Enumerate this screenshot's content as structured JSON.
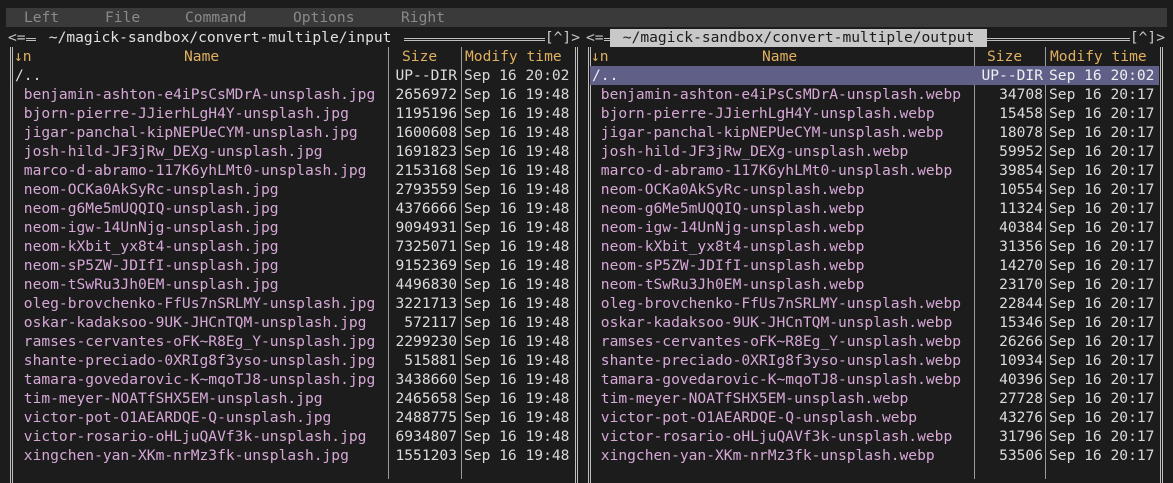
{
  "menu": [
    "Left",
    "File",
    "Command",
    "Options",
    "Right"
  ],
  "left_panel": {
    "corner_left": "<=",
    "path": " ~/magick-sandbox/convert-multiple/input ",
    "corner_right": "[^]>",
    "headers": {
      "sort": "↓n",
      "name": "Name",
      "size": "Size",
      "mtime": "Modify time"
    },
    "rows": [
      {
        "name": "/..",
        "size": "UP--DIR",
        "mtime": "Sep 16 20:02"
      },
      {
        "name": " benjamin-ashton-e4iPsCsMDrA-unsplash.jpg",
        "size": "2656972",
        "mtime": "Sep 16 19:48"
      },
      {
        "name": " bjorn-pierre-JJierhLgH4Y-unsplash.jpg",
        "size": "1195196",
        "mtime": "Sep 16 19:48"
      },
      {
        "name": " jigar-panchal-kipNEPUeCYM-unsplash.jpg",
        "size": "1600608",
        "mtime": "Sep 16 19:48"
      },
      {
        "name": " josh-hild-JF3jRw_DEXg-unsplash.jpg",
        "size": "1691823",
        "mtime": "Sep 16 19:48"
      },
      {
        "name": " marco-d-abramo-117K6yhLMt0-unsplash.jpg",
        "size": "2153168",
        "mtime": "Sep 16 19:48"
      },
      {
        "name": " neom-OCKa0AkSyRc-unsplash.jpg",
        "size": "2793559",
        "mtime": "Sep 16 19:48"
      },
      {
        "name": " neom-g6Me5mUQQIQ-unsplash.jpg",
        "size": "4376666",
        "mtime": "Sep 16 19:48"
      },
      {
        "name": " neom-igw-14UnNjg-unsplash.jpg",
        "size": "9094931",
        "mtime": "Sep 16 19:48"
      },
      {
        "name": " neom-kXbit_yx8t4-unsplash.jpg",
        "size": "7325071",
        "mtime": "Sep 16 19:48"
      },
      {
        "name": " neom-sP5ZW-JDIfI-unsplash.jpg",
        "size": "9152369",
        "mtime": "Sep 16 19:48"
      },
      {
        "name": " neom-tSwRu3Jh0EM-unsplash.jpg",
        "size": "4496830",
        "mtime": "Sep 16 19:48"
      },
      {
        "name": " oleg-brovchenko-FfUs7nSRLMY-unsplash.jpg",
        "size": "3221713",
        "mtime": "Sep 16 19:48"
      },
      {
        "name": " oskar-kadaksoo-9UK-JHCnTQM-unsplash.jpg",
        "size": "572117",
        "mtime": "Sep 16 19:48"
      },
      {
        "name": " ramses-cervantes-oFK~R8Eg_Y-unsplash.jpg",
        "size": "2299230",
        "mtime": "Sep 16 19:48"
      },
      {
        "name": " shante-preciado-0XRIg8f3yso-unsplash.jpg",
        "size": "515881",
        "mtime": "Sep 16 19:48"
      },
      {
        "name": " tamara-govedarovic-K~mqoTJ8-unsplash.jpg",
        "size": "3438660",
        "mtime": "Sep 16 19:48"
      },
      {
        "name": " tim-meyer-NOATfSHX5EM-unsplash.jpg",
        "size": "2465658",
        "mtime": "Sep 16 19:48"
      },
      {
        "name": " victor-pot-O1AEARDQE-Q-unsplash.jpg",
        "size": "2488775",
        "mtime": "Sep 16 19:48"
      },
      {
        "name": " victor-rosario-oHLjuQAVf3k-unsplash.jpg",
        "size": "6934807",
        "mtime": "Sep 16 19:48"
      },
      {
        "name": " xingchen-yan-XKm-nrMz3fk-unsplash.jpg",
        "size": "1551203",
        "mtime": "Sep 16 19:48"
      }
    ]
  },
  "right_panel": {
    "corner_left": "<=",
    "path": " ~/magick-sandbox/convert-multiple/output ",
    "corner_right": "[^]>",
    "headers": {
      "sort": "↓n",
      "name": "Name",
      "size": "Size",
      "mtime": "Modify time"
    },
    "rows": [
      {
        "name": "/..",
        "size": "UP--DIR",
        "mtime": "Sep 16 20:02"
      },
      {
        "name": " benjamin-ashton-e4iPsCsMDrA-unsplash.webp",
        "size": "34708",
        "mtime": "Sep 16 20:17"
      },
      {
        "name": " bjorn-pierre-JJierhLgH4Y-unsplash.webp",
        "size": "15458",
        "mtime": "Sep 16 20:17"
      },
      {
        "name": " jigar-panchal-kipNEPUeCYM-unsplash.webp",
        "size": "18078",
        "mtime": "Sep 16 20:17"
      },
      {
        "name": " josh-hild-JF3jRw_DEXg-unsplash.webp",
        "size": "59952",
        "mtime": "Sep 16 20:17"
      },
      {
        "name": " marco-d-abramo-117K6yhLMt0-unsplash.webp",
        "size": "39854",
        "mtime": "Sep 16 20:17"
      },
      {
        "name": " neom-OCKa0AkSyRc-unsplash.webp",
        "size": "10554",
        "mtime": "Sep 16 20:17"
      },
      {
        "name": " neom-g6Me5mUQQIQ-unsplash.webp",
        "size": "11324",
        "mtime": "Sep 16 20:17"
      },
      {
        "name": " neom-igw-14UnNjg-unsplash.webp",
        "size": "40384",
        "mtime": "Sep 16 20:17"
      },
      {
        "name": " neom-kXbit_yx8t4-unsplash.webp",
        "size": "31356",
        "mtime": "Sep 16 20:17"
      },
      {
        "name": " neom-sP5ZW-JDIfI-unsplash.webp",
        "size": "14270",
        "mtime": "Sep 16 20:17"
      },
      {
        "name": " neom-tSwRu3Jh0EM-unsplash.webp",
        "size": "23170",
        "mtime": "Sep 16 20:17"
      },
      {
        "name": " oleg-brovchenko-FfUs7nSRLMY-unsplash.webp",
        "size": "22844",
        "mtime": "Sep 16 20:17"
      },
      {
        "name": " oskar-kadaksoo-9UK-JHCnTQM-unsplash.webp",
        "size": "15346",
        "mtime": "Sep 16 20:17"
      },
      {
        "name": " ramses-cervantes-oFK~R8Eg_Y-unsplash.webp",
        "size": "26266",
        "mtime": "Sep 16 20:17"
      },
      {
        "name": " shante-preciado-0XRIg8f3yso-unsplash.webp",
        "size": "10934",
        "mtime": "Sep 16 20:17"
      },
      {
        "name": " tamara-govedarovic-K~mqoTJ8-unsplash.webp",
        "size": "40396",
        "mtime": "Sep 16 20:17"
      },
      {
        "name": " tim-meyer-NOATfSHX5EM-unsplash.webp",
        "size": "27728",
        "mtime": "Sep 16 20:17"
      },
      {
        "name": " victor-pot-O1AEARDQE-Q-unsplash.webp",
        "size": "43276",
        "mtime": "Sep 16 20:17"
      },
      {
        "name": " victor-rosario-oHLjuQAVf3k-unsplash.webp",
        "size": "31796",
        "mtime": "Sep 16 20:17"
      },
      {
        "name": " xingchen-yan-XKm-nrMz3fk-unsplash.webp",
        "size": "53506",
        "mtime": "Sep 16 20:17"
      }
    ],
    "cursor_row": 0
  }
}
